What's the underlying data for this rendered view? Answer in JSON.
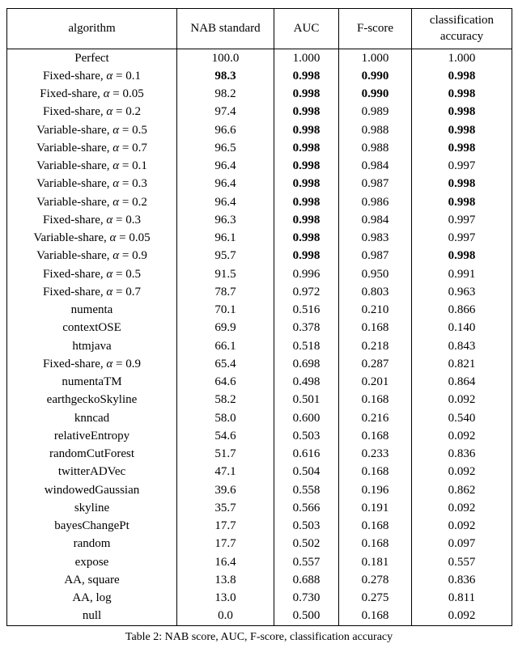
{
  "headers": {
    "algorithm": "algorithm",
    "nab": "NAB standard",
    "auc": "AUC",
    "fscore": "F-score",
    "acc1": "classification",
    "acc2": "accuracy"
  },
  "alpha_glyph": "α",
  "rows": [
    {
      "alg": "Perfect",
      "nab": "100.0",
      "nab_b": false,
      "auc": "1.000",
      "auc_b": false,
      "f": "1.000",
      "f_b": false,
      "acc": "1.000",
      "acc_b": false
    },
    {
      "alg_prefix": "Fixed-share, ",
      "alpha": "0.1",
      "nab": "98.3",
      "nab_b": true,
      "auc": "0.998",
      "auc_b": true,
      "f": "0.990",
      "f_b": true,
      "acc": "0.998",
      "acc_b": true
    },
    {
      "alg_prefix": "Fixed-share, ",
      "alpha": "0.05",
      "nab": "98.2",
      "nab_b": false,
      "auc": "0.998",
      "auc_b": true,
      "f": "0.990",
      "f_b": true,
      "acc": "0.998",
      "acc_b": true
    },
    {
      "alg_prefix": "Fixed-share, ",
      "alpha": "0.2",
      "nab": "97.4",
      "nab_b": false,
      "auc": "0.998",
      "auc_b": true,
      "f": "0.989",
      "f_b": false,
      "acc": "0.998",
      "acc_b": true
    },
    {
      "alg_prefix": "Variable-share, ",
      "alpha": "0.5",
      "nab": "96.6",
      "nab_b": false,
      "auc": "0.998",
      "auc_b": true,
      "f": "0.988",
      "f_b": false,
      "acc": "0.998",
      "acc_b": true
    },
    {
      "alg_prefix": "Variable-share, ",
      "alpha": "0.7",
      "nab": "96.5",
      "nab_b": false,
      "auc": "0.998",
      "auc_b": true,
      "f": "0.988",
      "f_b": false,
      "acc": "0.998",
      "acc_b": true
    },
    {
      "alg_prefix": "Variable-share, ",
      "alpha": "0.1",
      "nab": "96.4",
      "nab_b": false,
      "auc": "0.998",
      "auc_b": true,
      "f": "0.984",
      "f_b": false,
      "acc": "0.997",
      "acc_b": false
    },
    {
      "alg_prefix": "Variable-share, ",
      "alpha": "0.3",
      "nab": "96.4",
      "nab_b": false,
      "auc": "0.998",
      "auc_b": true,
      "f": "0.987",
      "f_b": false,
      "acc": "0.998",
      "acc_b": true
    },
    {
      "alg_prefix": "Variable-share, ",
      "alpha": "0.2",
      "nab": "96.4",
      "nab_b": false,
      "auc": "0.998",
      "auc_b": true,
      "f": "0.986",
      "f_b": false,
      "acc": "0.998",
      "acc_b": true
    },
    {
      "alg_prefix": "Fixed-share, ",
      "alpha": "0.3",
      "nab": "96.3",
      "nab_b": false,
      "auc": "0.998",
      "auc_b": true,
      "f": "0.984",
      "f_b": false,
      "acc": "0.997",
      "acc_b": false
    },
    {
      "alg_prefix": "Variable-share, ",
      "alpha": "0.05",
      "nab": "96.1",
      "nab_b": false,
      "auc": "0.998",
      "auc_b": true,
      "f": "0.983",
      "f_b": false,
      "acc": "0.997",
      "acc_b": false
    },
    {
      "alg_prefix": "Variable-share, ",
      "alpha": "0.9",
      "nab": "95.7",
      "nab_b": false,
      "auc": "0.998",
      "auc_b": true,
      "f": "0.987",
      "f_b": false,
      "acc": "0.998",
      "acc_b": true
    },
    {
      "alg_prefix": "Fixed-share, ",
      "alpha": "0.5",
      "nab": "91.5",
      "nab_b": false,
      "auc": "0.996",
      "auc_b": false,
      "f": "0.950",
      "f_b": false,
      "acc": "0.991",
      "acc_b": false
    },
    {
      "alg_prefix": "Fixed-share, ",
      "alpha": "0.7",
      "nab": "78.7",
      "nab_b": false,
      "auc": "0.972",
      "auc_b": false,
      "f": "0.803",
      "f_b": false,
      "acc": "0.963",
      "acc_b": false
    },
    {
      "alg": "numenta",
      "nab": "70.1",
      "nab_b": false,
      "auc": "0.516",
      "auc_b": false,
      "f": "0.210",
      "f_b": false,
      "acc": "0.866",
      "acc_b": false
    },
    {
      "alg": "contextOSE",
      "nab": "69.9",
      "nab_b": false,
      "auc": "0.378",
      "auc_b": false,
      "f": "0.168",
      "f_b": false,
      "acc": "0.140",
      "acc_b": false
    },
    {
      "alg": "htmjava",
      "nab": "66.1",
      "nab_b": false,
      "auc": "0.518",
      "auc_b": false,
      "f": "0.218",
      "f_b": false,
      "acc": "0.843",
      "acc_b": false
    },
    {
      "alg_prefix": "Fixed-share, ",
      "alpha": "0.9",
      "nab": "65.4",
      "nab_b": false,
      "auc": "0.698",
      "auc_b": false,
      "f": "0.287",
      "f_b": false,
      "acc": "0.821",
      "acc_b": false
    },
    {
      "alg": "numentaTM",
      "nab": "64.6",
      "nab_b": false,
      "auc": "0.498",
      "auc_b": false,
      "f": "0.201",
      "f_b": false,
      "acc": "0.864",
      "acc_b": false
    },
    {
      "alg": "earthgeckoSkyline",
      "nab": "58.2",
      "nab_b": false,
      "auc": "0.501",
      "auc_b": false,
      "f": "0.168",
      "f_b": false,
      "acc": "0.092",
      "acc_b": false
    },
    {
      "alg": "knncad",
      "nab": "58.0",
      "nab_b": false,
      "auc": "0.600",
      "auc_b": false,
      "f": "0.216",
      "f_b": false,
      "acc": "0.540",
      "acc_b": false
    },
    {
      "alg": "relativeEntropy",
      "nab": "54.6",
      "nab_b": false,
      "auc": "0.503",
      "auc_b": false,
      "f": "0.168",
      "f_b": false,
      "acc": "0.092",
      "acc_b": false
    },
    {
      "alg": "randomCutForest",
      "nab": "51.7",
      "nab_b": false,
      "auc": "0.616",
      "auc_b": false,
      "f": "0.233",
      "f_b": false,
      "acc": "0.836",
      "acc_b": false
    },
    {
      "alg": "twitterADVec",
      "nab": "47.1",
      "nab_b": false,
      "auc": "0.504",
      "auc_b": false,
      "f": "0.168",
      "f_b": false,
      "acc": "0.092",
      "acc_b": false
    },
    {
      "alg": "windowedGaussian",
      "nab": "39.6",
      "nab_b": false,
      "auc": "0.558",
      "auc_b": false,
      "f": "0.196",
      "f_b": false,
      "acc": "0.862",
      "acc_b": false
    },
    {
      "alg": "skyline",
      "nab": "35.7",
      "nab_b": false,
      "auc": "0.566",
      "auc_b": false,
      "f": "0.191",
      "f_b": false,
      "acc": "0.092",
      "acc_b": false
    },
    {
      "alg": "bayesChangePt",
      "nab": "17.7",
      "nab_b": false,
      "auc": "0.503",
      "auc_b": false,
      "f": "0.168",
      "f_b": false,
      "acc": "0.092",
      "acc_b": false
    },
    {
      "alg": "random",
      "nab": "17.7",
      "nab_b": false,
      "auc": "0.502",
      "auc_b": false,
      "f": "0.168",
      "f_b": false,
      "acc": "0.097",
      "acc_b": false
    },
    {
      "alg": "expose",
      "nab": "16.4",
      "nab_b": false,
      "auc": "0.557",
      "auc_b": false,
      "f": "0.181",
      "f_b": false,
      "acc": "0.557",
      "acc_b": false
    },
    {
      "alg": "AA, square",
      "nab": "13.8",
      "nab_b": false,
      "auc": "0.688",
      "auc_b": false,
      "f": "0.278",
      "f_b": false,
      "acc": "0.836",
      "acc_b": false
    },
    {
      "alg": "AA, log",
      "nab": "13.0",
      "nab_b": false,
      "auc": "0.730",
      "auc_b": false,
      "f": "0.275",
      "f_b": false,
      "acc": "0.811",
      "acc_b": false
    },
    {
      "alg": "null",
      "nab": "0.0",
      "nab_b": false,
      "auc": "0.500",
      "auc_b": false,
      "f": "0.168",
      "f_b": false,
      "acc": "0.092",
      "acc_b": false
    }
  ],
  "caption": "Table 2: NAB score, AUC, F-score, classification accuracy"
}
